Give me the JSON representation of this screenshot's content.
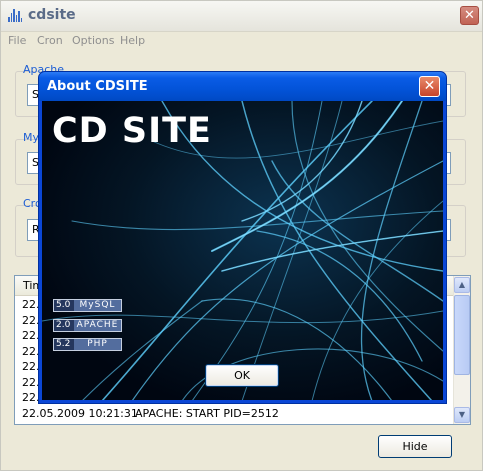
{
  "main_window": {
    "title": "cdsite",
    "menu": [
      "File",
      "Cron",
      "Options",
      "Help"
    ],
    "groups": {
      "apache_label": "Apache",
      "mysql_label": "MyS",
      "cron_label": "Cro"
    },
    "stubs": {
      "apache": "S",
      "mysql": "S",
      "cron": "R"
    },
    "log": {
      "header": "Tim",
      "rows": [
        {
          "time": "22.0",
          "message": ""
        },
        {
          "time": "22.0",
          "message": ""
        },
        {
          "time": "22.0",
          "message": ""
        },
        {
          "time": "22.0",
          "message": ""
        },
        {
          "time": "22.0",
          "message": ""
        },
        {
          "time": "22.0",
          "message": ""
        },
        {
          "time": "22.0",
          "message": ""
        },
        {
          "time": "22.05.2009 10:21:31",
          "message": "APACHE: START PID=2512"
        }
      ]
    },
    "hide_label": "Hide"
  },
  "about_dialog": {
    "title": "About CDSITE",
    "logo_text": "CD SITE",
    "components": [
      {
        "version": "5.0",
        "name": "MySQL"
      },
      {
        "version": "2.0",
        "name": "APACHE"
      },
      {
        "version": "5.2",
        "name": "PHP"
      }
    ],
    "ok_label": "OK"
  },
  "colors": {
    "dialog_title_blue": "#0a5ce6",
    "group_label_blue": "#1d5ed4",
    "fiber_cyan": "#5fd2ff",
    "background_dark": "#000611"
  },
  "icons": {
    "app": "equalizer-bars-icon",
    "close": "close-x-icon",
    "scroll_up": "arrow-up-icon",
    "scroll_down": "arrow-down-icon"
  }
}
